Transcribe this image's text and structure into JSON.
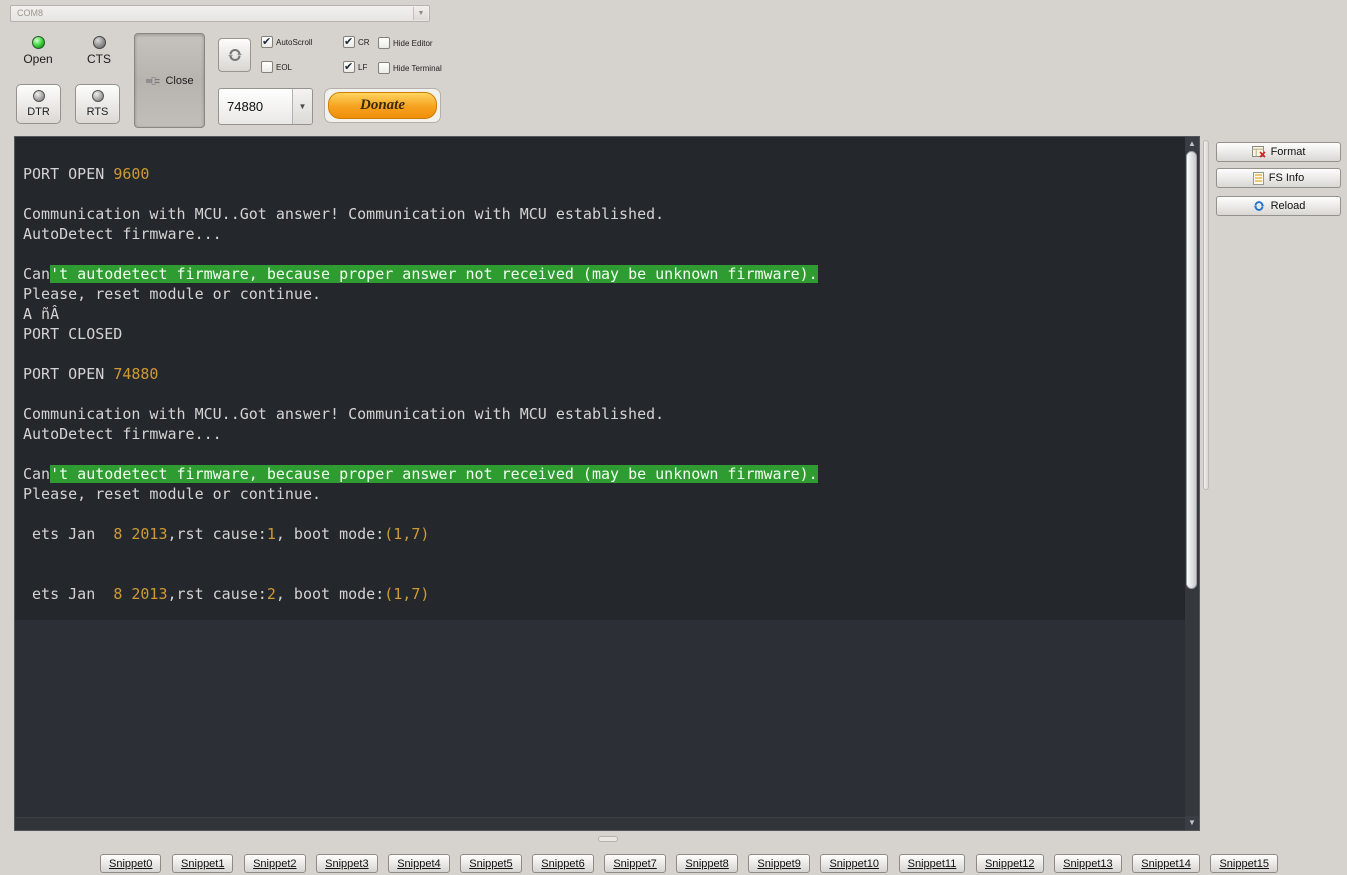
{
  "toolbar": {
    "port_combo": {
      "value": "COM8"
    },
    "open": {
      "label": "Open"
    },
    "cts": {
      "label": "CTS"
    },
    "close": {
      "label": "Close"
    },
    "dtr": {
      "label": "DTR"
    },
    "rts": {
      "label": "RTS"
    },
    "baud_combo": {
      "value": "74880"
    },
    "donate": {
      "label": "Donate"
    },
    "checkboxes": {
      "autoscroll": {
        "label": "AutoScroll",
        "checked": true
      },
      "eol": {
        "label": "EOL",
        "checked": false
      },
      "cr": {
        "label": "CR",
        "checked": true
      },
      "lf": {
        "label": "LF",
        "checked": true
      },
      "hide_editor": {
        "label": "Hide Editor",
        "checked": false
      },
      "hide_terminal": {
        "label": "Hide Terminal",
        "checked": false
      }
    }
  },
  "terminal": {
    "colors": {
      "bg": "#24282c",
      "bg_lower": "#2c3036",
      "text": "#d2d3d3",
      "number": "#cf9a33",
      "highlight_bg": "#2f9c31",
      "highlight_text": "#f2fff2"
    },
    "lines": [
      [
        {
          "t": "PORT OPEN ",
          "c": "text"
        },
        {
          "t": "9600",
          "c": "number"
        }
      ],
      [],
      [
        {
          "t": "Communication with MCU..Got answer! Communication with MCU established.",
          "c": "text"
        }
      ],
      [
        {
          "t": "AutoDetect firmware...",
          "c": "text"
        }
      ],
      [],
      [
        {
          "t": "Can",
          "c": "text"
        },
        {
          "t": "'t autodetect firmware, because proper answer not received (may be unknown firmware).",
          "c": "hl"
        }
      ],
      [
        {
          "t": "Please, reset module or continue.",
          "c": "text"
        }
      ],
      [
        {
          "t": "A ñÂ",
          "c": "text"
        }
      ],
      [
        {
          "t": "PORT CLOSED",
          "c": "text"
        }
      ],
      [],
      [
        {
          "t": "PORT OPEN ",
          "c": "text"
        },
        {
          "t": "74880",
          "c": "number"
        }
      ],
      [],
      [
        {
          "t": "Communication with MCU..Got answer! Communication with MCU established.",
          "c": "text"
        }
      ],
      [
        {
          "t": "AutoDetect firmware...",
          "c": "text"
        }
      ],
      [],
      [
        {
          "t": "Can",
          "c": "text"
        },
        {
          "t": "'t autodetect firmware, because proper answer not received (may be unknown firmware).",
          "c": "hl"
        }
      ],
      [
        {
          "t": "Please, reset module or continue.",
          "c": "text"
        }
      ],
      [],
      [
        {
          "t": " ets Jan  ",
          "c": "text"
        },
        {
          "t": "8 2013",
          "c": "number"
        },
        {
          "t": ",rst cause:",
          "c": "text"
        },
        {
          "t": "1",
          "c": "number"
        },
        {
          "t": ", boot mode:",
          "c": "text"
        },
        {
          "t": "(1,7)",
          "c": "number"
        }
      ],
      [],
      [],
      [
        {
          "t": " ets Jan  ",
          "c": "text"
        },
        {
          "t": "8 2013",
          "c": "number"
        },
        {
          "t": ",rst cause:",
          "c": "text"
        },
        {
          "t": "2",
          "c": "number"
        },
        {
          "t": ", boot mode:",
          "c": "text"
        },
        {
          "t": "(1,7)",
          "c": "number"
        }
      ]
    ]
  },
  "side_panel": {
    "format": {
      "label": "Format"
    },
    "fs_info": {
      "label": "FS Info"
    },
    "reload": {
      "label": "Reload"
    }
  },
  "snippets": {
    "buttons": [
      "Snippet0",
      "Snippet1",
      "Snippet2",
      "Snippet3",
      "Snippet4",
      "Snippet5",
      "Snippet6",
      "Snippet7",
      "Snippet8",
      "Snippet9",
      "Snippet10",
      "Snippet11",
      "Snippet12",
      "Snippet13",
      "Snippet14",
      "Snippet15"
    ]
  }
}
